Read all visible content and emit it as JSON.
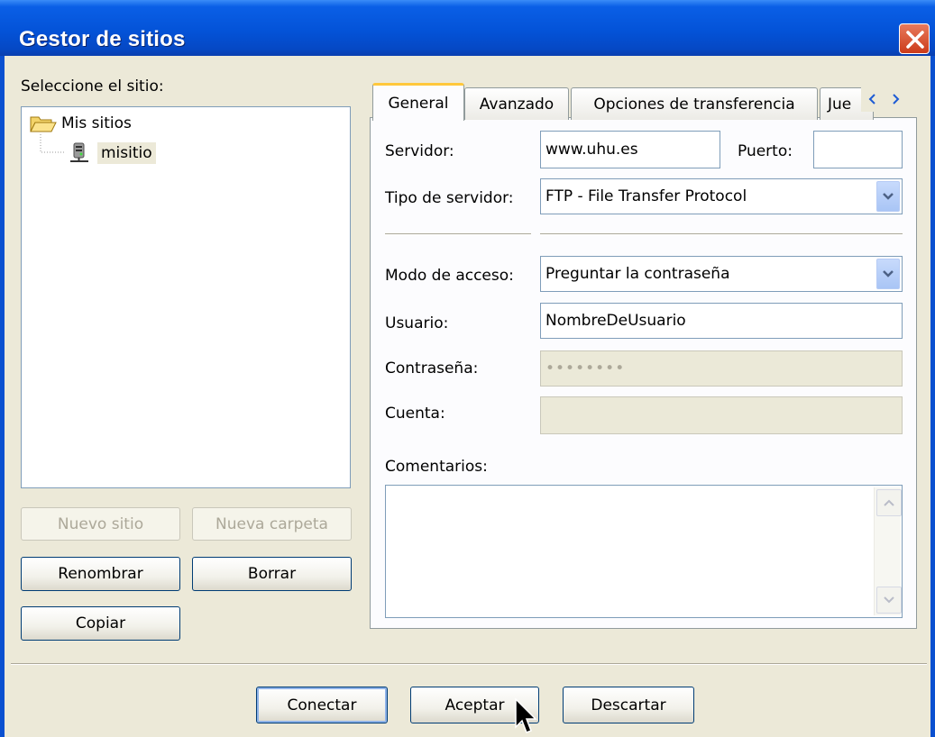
{
  "window": {
    "title": "Gestor de sitios"
  },
  "left": {
    "select_label": "Seleccione el sitio:",
    "tree": {
      "root": "Mis sitios",
      "child": "misitio"
    },
    "buttons": {
      "new_site": "Nuevo sitio",
      "new_folder": "Nueva carpeta",
      "rename": "Renombrar",
      "delete": "Borrar",
      "copy": "Copiar"
    }
  },
  "tabs": [
    "General",
    "Avanzado",
    "Opciones de transferencia",
    "Jue"
  ],
  "general": {
    "server_label": "Servidor:",
    "server_value": "www.uhu.es",
    "port_label": "Puerto:",
    "port_value": "",
    "server_type_label": "Tipo de servidor:",
    "server_type_value": "FTP - File Transfer Protocol",
    "access_mode_label": "Modo de acceso:",
    "access_mode_value": "Preguntar la contraseña",
    "user_label": "Usuario:",
    "user_value": "NombreDeUsuario",
    "password_label": "Contraseña:",
    "password_value": "••••••••",
    "account_label": "Cuenta:",
    "account_value": "",
    "comments_label": "Comentarios:",
    "comments_value": ""
  },
  "footer": {
    "connect": "Conectar",
    "accept": "Aceptar",
    "discard": "Descartar"
  },
  "icons": [
    "close-icon",
    "folder-open-icon",
    "server-icon",
    "chevron-down-icon",
    "arrow-left-icon",
    "arrow-right-icon",
    "scroll-up-icon",
    "scroll-down-icon",
    "mouse-cursor-icon"
  ],
  "colors": {
    "titlebar": "#0453d8",
    "dialog_bg": "#ece9d8",
    "active_tab_accent": "#ffc83c",
    "close_button": "#cc3b1a"
  }
}
